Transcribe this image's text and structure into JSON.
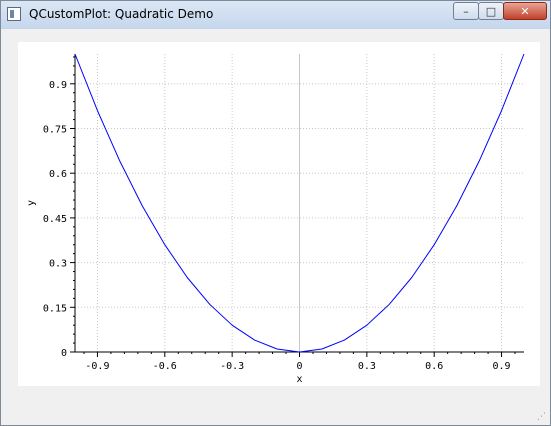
{
  "window": {
    "title": "QCustomPlot: Quadratic Demo",
    "icon": "app-window-icon",
    "controls": {
      "minimize": "–",
      "maximize": "□",
      "close": "✕"
    }
  },
  "colors": {
    "curve": "#0000ff",
    "grid": "#c8c8c8",
    "zero_line": "#c8c8c8",
    "axis": "#000000"
  },
  "chart_data": {
    "type": "line",
    "title": "",
    "xlabel": "x",
    "ylabel": "y",
    "xlim": [
      -1,
      1
    ],
    "ylim": [
      0,
      1
    ],
    "x_ticks": [
      -0.9,
      -0.6,
      -0.3,
      0,
      0.3,
      0.6,
      0.9
    ],
    "x_tick_labels": [
      "-0.9",
      "-0.6",
      "-0.3",
      "0",
      "0.3",
      "0.6",
      "0.9"
    ],
    "y_ticks": [
      0,
      0.15,
      0.3,
      0.45,
      0.6,
      0.75,
      0.9
    ],
    "y_tick_labels": [
      "0",
      "0.15",
      "0.3",
      "0.45",
      "0.6",
      "0.75",
      "0.9"
    ],
    "grid": true,
    "series": [
      {
        "formula": "y = x^2",
        "x": [
          -1,
          -0.9,
          -0.8,
          -0.7,
          -0.6,
          -0.5,
          -0.4,
          -0.3,
          -0.2,
          -0.1,
          0,
          0.1,
          0.2,
          0.3,
          0.4,
          0.5,
          0.6,
          0.7,
          0.8,
          0.9,
          1
        ],
        "y": [
          1,
          0.81,
          0.64,
          0.49,
          0.36,
          0.25,
          0.16,
          0.09,
          0.04,
          0.01,
          0,
          0.01,
          0.04,
          0.09,
          0.16,
          0.25,
          0.36,
          0.49,
          0.64,
          0.81,
          1
        ]
      }
    ]
  }
}
